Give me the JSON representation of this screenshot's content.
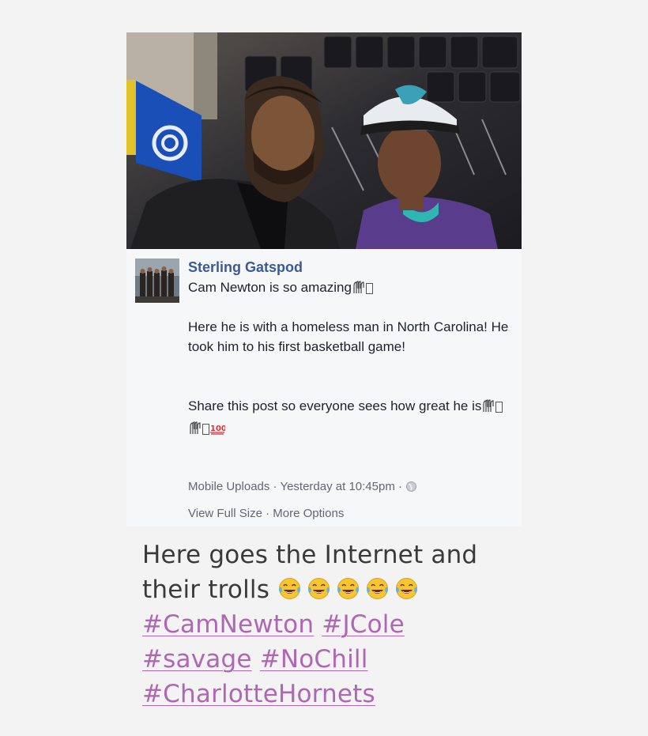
{
  "post": {
    "author": "Sterling Gatspod",
    "line1": "Cam Newton is so amazing",
    "paragraph1": "Here he is with a homeless man in North Carolina! He took him to his first basketball game!",
    "paragraph2": "Share this post so everyone sees how great he is",
    "meta_source": "Mobile Uploads",
    "meta_time": "Yesterday at 10:45pm",
    "link_full": "View Full Size",
    "link_options": "More Options",
    "separator": " · "
  },
  "caption": {
    "text": "Here goes the Internet and their trolls",
    "emoji_count": 5,
    "hashtags": [
      "#CamNewton",
      "#JCole",
      "#savage",
      "#NoChill",
      "#CharlotteHornets"
    ]
  },
  "colors": {
    "author": "#3b5998",
    "hashtag": "#b066b4",
    "background": "#f3f3f3"
  },
  "icons": [
    "praise-hands-icon",
    "hundred-icon",
    "globe-icon",
    "tears-of-joy-icon"
  ]
}
